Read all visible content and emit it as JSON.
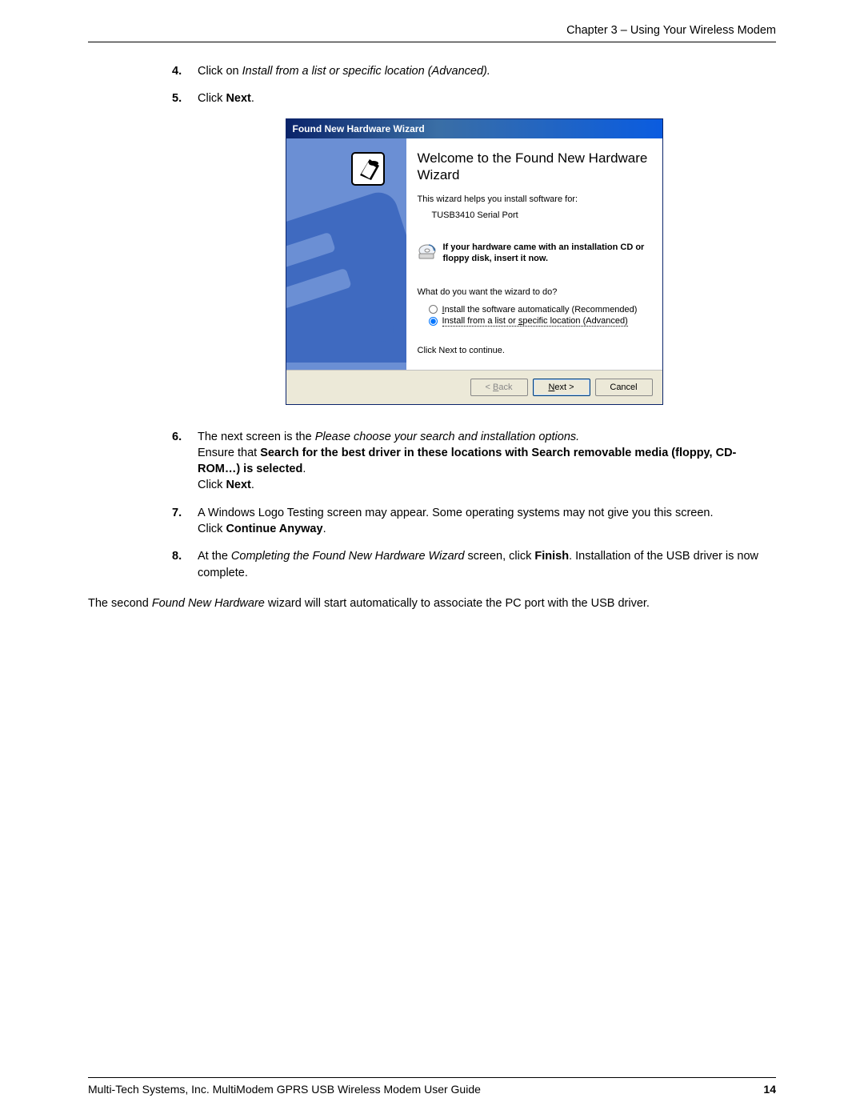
{
  "header": {
    "chapter": "Chapter 3 – Using Your Wireless Modem"
  },
  "steps": {
    "s4": {
      "num": "4.",
      "pre": "Click on ",
      "ital": "Install from a list or specific location (Advanced).",
      "post": ""
    },
    "s5": {
      "num": "5.",
      "pre": "Click ",
      "bold": "Next",
      "post": "."
    },
    "s6": {
      "num": "6.",
      "line1_pre": "The next screen is the ",
      "line1_ital": "Please choose your search and installation options.",
      "line2_pre": "Ensure that ",
      "line2_bold": "Search for the best driver in these locations with Search removable media (floppy, CD-ROM…) is selected",
      "line2_post": ".",
      "line3_pre": "Click ",
      "line3_bold": "Next",
      "line3_post": "."
    },
    "s7": {
      "num": "7.",
      "line1": "A Windows Logo Testing screen may appear.  Some operating systems may not give you this screen.",
      "line2_pre": "Click ",
      "line2_bold": "Continue Anyway",
      "line2_post": "."
    },
    "s8": {
      "num": "8.",
      "pre": "At the ",
      "ital": "Completing the Found New Hardware Wizard",
      "mid": " screen, click ",
      "bold": "Finish",
      "post": ". Installation of the USB driver is now complete."
    }
  },
  "wizard": {
    "title": "Found New Hardware Wizard",
    "heading": "Welcome to the Found New Hardware Wizard",
    "helps": "This wizard helps you install software for:",
    "device": "TUSB3410 Serial Port",
    "cd_text": "If your hardware came with an installation CD or floppy disk, insert it now.",
    "prompt": "What do you want the wizard to do?",
    "opt1_pre": "I",
    "opt1_u": "",
    "opt1_text": "nstall the software automatically (Recommended)",
    "opt2_text": "Install from a list or ",
    "opt2_u": "s",
    "opt2_post": "pecific location (Advanced)",
    "cont": "Click Next to continue.",
    "btn_back_u": "B",
    "btn_back": "ack",
    "btn_next_u": "N",
    "btn_next": "ext >",
    "btn_cancel": "Cancel"
  },
  "body": {
    "para_pre": "The second ",
    "para_ital": "Found New Hardware",
    "para_post": " wizard will start automatically to associate the PC port with the USB driver."
  },
  "footer": {
    "text": "Multi-Tech Systems, Inc. MultiModem GPRS USB Wireless Modem User Guide",
    "page": "14"
  }
}
